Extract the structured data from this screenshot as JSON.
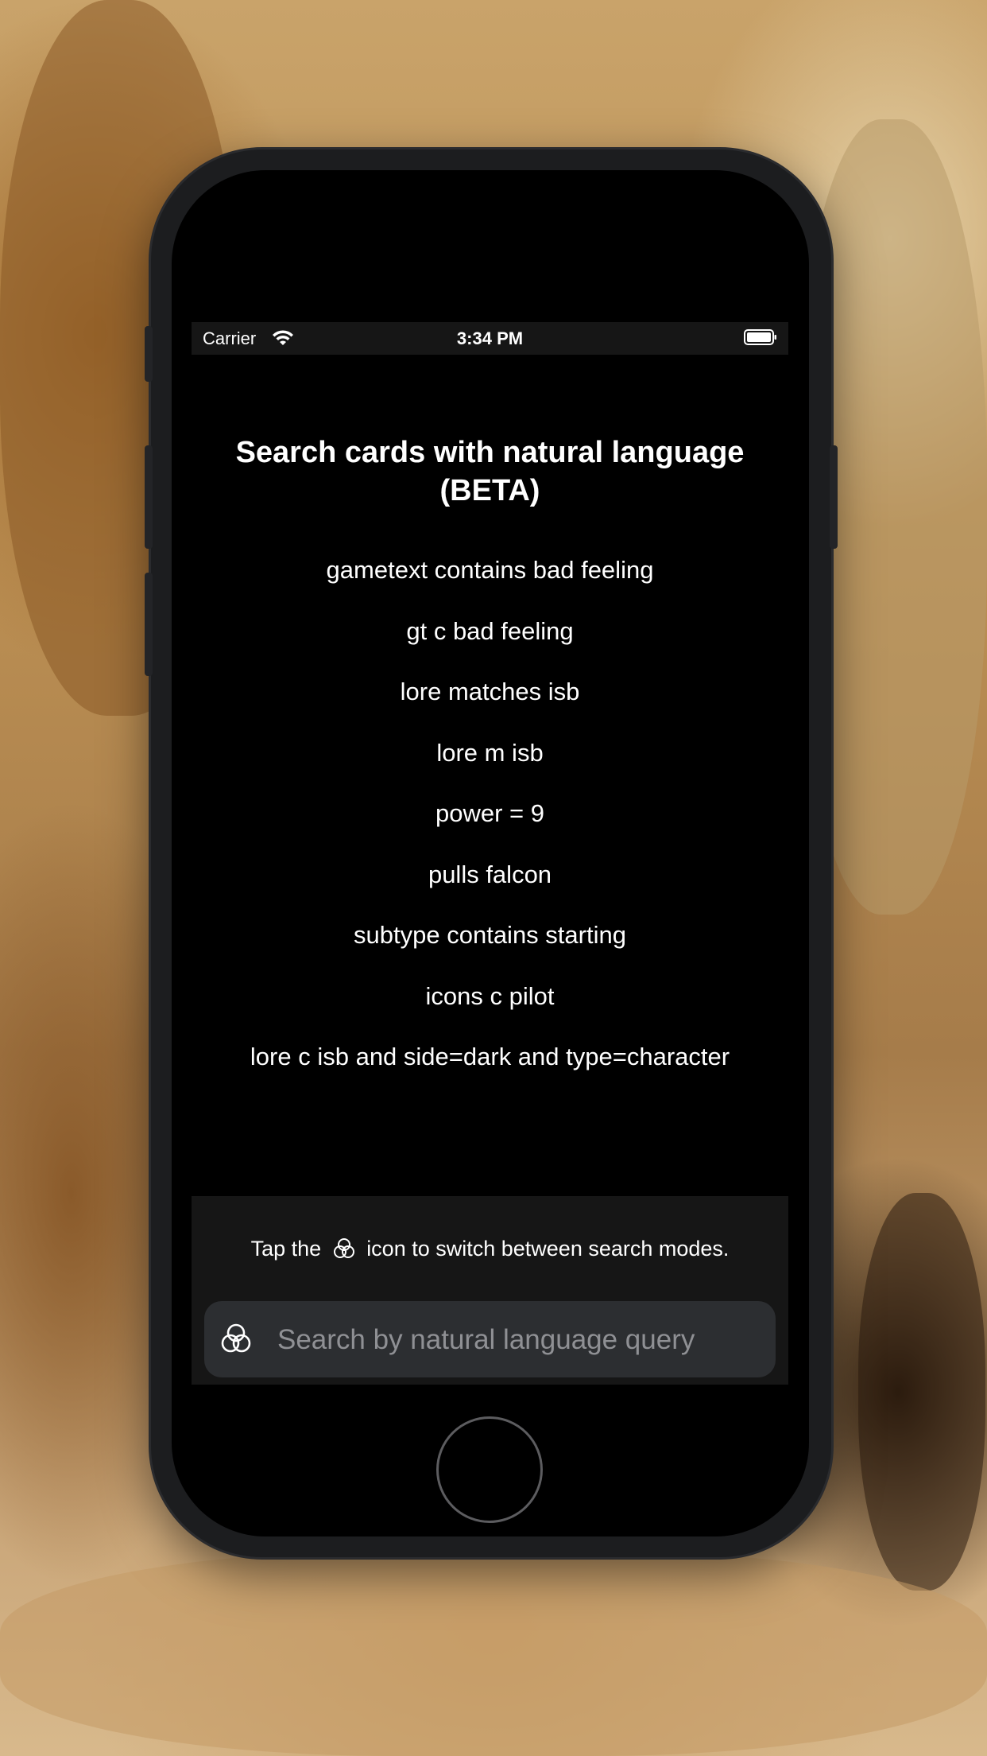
{
  "status_bar": {
    "carrier": "Carrier",
    "time": "3:34 PM"
  },
  "page": {
    "title": "Search cards with natural language (BETA)"
  },
  "examples": [
    "gametext contains bad feeling",
    "gt c bad feeling",
    "lore matches isb",
    "lore m isb",
    "power = 9",
    "pulls falcon",
    "subtype contains starting",
    "icons c pilot",
    "lore c isb and side=dark and type=character"
  ],
  "hint": {
    "before": "Tap the",
    "after": "icon to switch between search modes.",
    "icon": "search-mode-icon"
  },
  "search": {
    "placeholder": "Search by natural language query",
    "value": "",
    "mode_icon": "three-circles-icon"
  },
  "colors": {
    "screen_bg": "#000000",
    "panel_bg": "#161616",
    "search_field_bg": "#2c2e31",
    "placeholder": "#8f9094",
    "text": "#ffffff"
  }
}
